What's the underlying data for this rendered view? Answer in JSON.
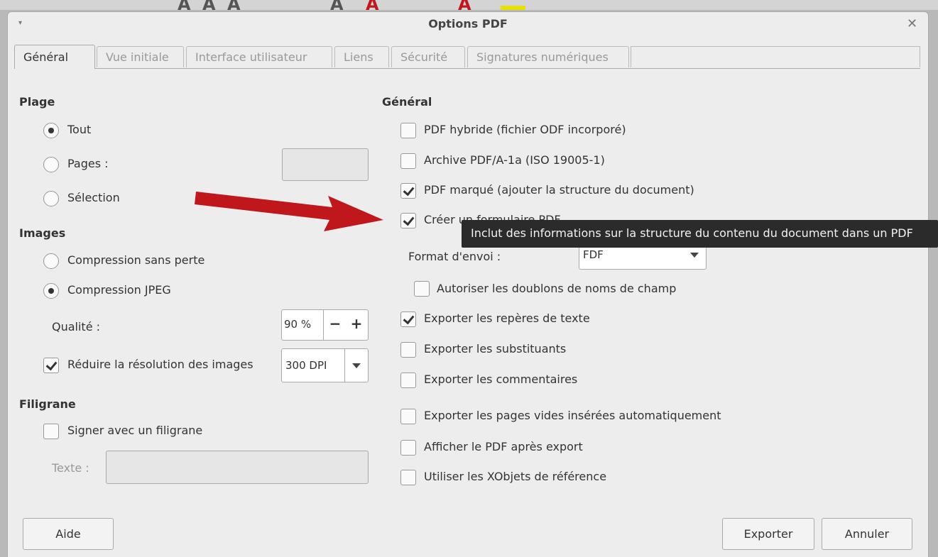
{
  "dialog": {
    "title": "Options PDF",
    "menu_glyph": "▾",
    "close_glyph": "✕"
  },
  "tabs": [
    {
      "label": "Général"
    },
    {
      "label": "Vue initiale"
    },
    {
      "label": "Interface utilisateur"
    },
    {
      "label": "Liens"
    },
    {
      "label": "Sécurité"
    },
    {
      "label": "Signatures numériques"
    }
  ],
  "left": {
    "range_title": "Plage",
    "range_options": [
      {
        "label": "Tout",
        "selected": true
      },
      {
        "label": "Pages :",
        "selected": false
      },
      {
        "label": "Sélection",
        "selected": false
      }
    ],
    "pages_input_value": "",
    "images_title": "Images",
    "image_options": [
      {
        "label": "Compression sans perte",
        "selected": false
      },
      {
        "label": "Compression JPEG",
        "selected": true
      }
    ],
    "quality_label": "Qualité :",
    "quality_value": "90 %",
    "minus": "−",
    "plus": "+",
    "reduce_label": "Réduire la résolution des images",
    "reduce_checked": true,
    "dpi_value": "300 DPI",
    "watermark_title": "Filigrane",
    "sign_label": "Signer avec un filigrane",
    "sign_checked": false,
    "text_label": "Texte :",
    "text_value": ""
  },
  "right": {
    "general_title": "Général",
    "options": [
      {
        "label": "PDF hybride (fichier ODF incorporé)",
        "checked": false
      },
      {
        "label": "Archive PDF/A-1a (ISO 19005-1)",
        "checked": false
      },
      {
        "label": "PDF marqué (ajouter la structure du document)",
        "checked": true
      },
      {
        "label": "Créer un formulaire PDF",
        "checked": true
      }
    ],
    "format_label": "Format d'envoi :",
    "format_value": "FDF",
    "duplicates_label": "Autoriser les doublons de noms de champ",
    "duplicates_checked": false,
    "more_options": [
      {
        "label": "Exporter les repères de texte",
        "checked": true
      },
      {
        "label": "Exporter les substituants",
        "checked": false
      },
      {
        "label": "Exporter les commentaires",
        "checked": false
      },
      {
        "label": "Exporter les pages vides insérées automatiquement",
        "checked": false
      },
      {
        "label": "Afficher le PDF après export",
        "checked": false
      },
      {
        "label": "Utiliser les XObjets de référence",
        "checked": false
      }
    ]
  },
  "tooltip": {
    "text": "Inclut des informations sur la structure du contenu du document dans un PDF"
  },
  "buttons": {
    "help": "Aide",
    "export": "Exporter",
    "cancel": "Annuler"
  },
  "annotation": {
    "arrow_color": "#c0171c"
  }
}
